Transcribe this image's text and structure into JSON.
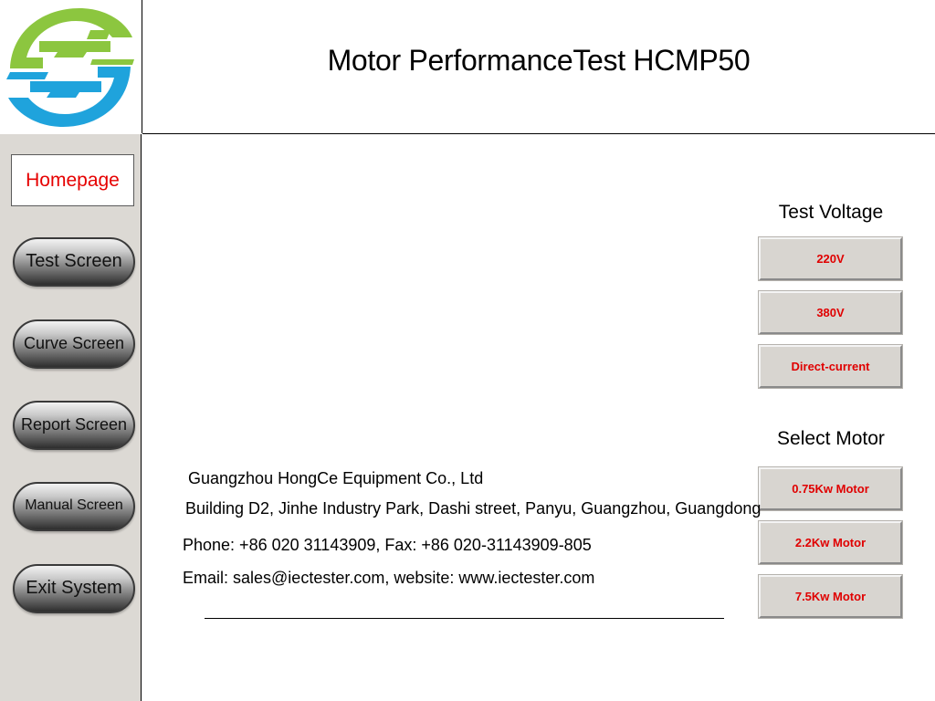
{
  "header": {
    "title": "Motor PerformanceTest HCMP50"
  },
  "logo": {
    "icon": "hongce-logo",
    "colors": {
      "green": "#8cc63f",
      "blue": "#1fa3dc"
    }
  },
  "sidebar": {
    "home_label": "Homepage",
    "items": [
      {
        "label": "Test Screen"
      },
      {
        "label": "Curve Screen"
      },
      {
        "label": "Report Screen"
      },
      {
        "label": "Manual Screen"
      },
      {
        "label": "Exit System"
      }
    ]
  },
  "test_voltage": {
    "label": "Test Voltage",
    "options": [
      "220V",
      "380V",
      "Direct-current"
    ]
  },
  "select_motor": {
    "label": "Select Motor",
    "options": [
      "0.75Kw Motor",
      "2.2Kw Motor",
      "7.5Kw Motor"
    ]
  },
  "company": {
    "name": "Guangzhou HongCe Equipment Co., Ltd",
    "address": "Building D2, Jinhe Industry Park, Dashi street, Panyu, Guangzhou, Guangdong",
    "phone": "Phone: +86 020 31143909, Fax: +86 020-31143909-805",
    "email": "Email: sales@iectester.com, website: www.iectester.com"
  },
  "colors": {
    "accent_red": "#e00000",
    "sidebar_bg": "#dcd9d4"
  }
}
